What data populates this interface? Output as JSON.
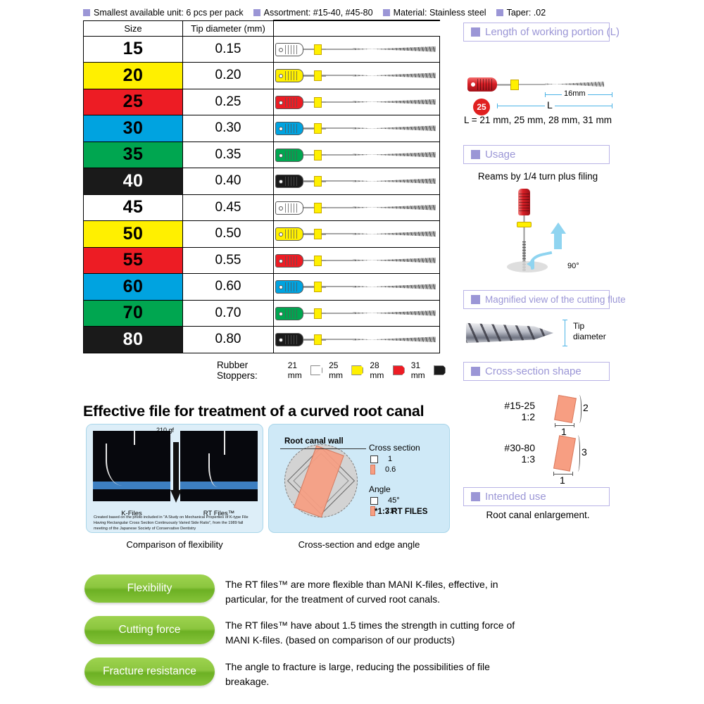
{
  "specs": [
    {
      "label": "Smallest available unit: 6 pcs per pack"
    },
    {
      "label": "Assortment: #15-40, #45-80"
    },
    {
      "label": "Material: Stainless steel"
    },
    {
      "label": "Taper: .02"
    }
  ],
  "table": {
    "headers": {
      "size": "Size",
      "diameter": "Tip diameter (mm)"
    },
    "rows": [
      {
        "size": "15",
        "diameter": "0.15",
        "color": "#FFFFFF",
        "text_color": "#000000"
      },
      {
        "size": "20",
        "diameter": "0.20",
        "color": "#FFF000",
        "text_color": "#000000"
      },
      {
        "size": "25",
        "diameter": "0.25",
        "color": "#ED1C24",
        "text_color": "#000000"
      },
      {
        "size": "30",
        "diameter": "0.30",
        "color": "#00A3E0",
        "text_color": "#000000"
      },
      {
        "size": "35",
        "diameter": "0.35",
        "color": "#00A650",
        "text_color": "#000000"
      },
      {
        "size": "40",
        "diameter": "0.40",
        "color": "#1A1A1A",
        "text_color": "#FFFFFF"
      },
      {
        "size": "45",
        "diameter": "0.45",
        "color": "#FFFFFF",
        "text_color": "#000000"
      },
      {
        "size": "50",
        "diameter": "0.50",
        "color": "#FFF000",
        "text_color": "#000000"
      },
      {
        "size": "55",
        "diameter": "0.55",
        "color": "#ED1C24",
        "text_color": "#000000"
      },
      {
        "size": "60",
        "diameter": "0.60",
        "color": "#00A3E0",
        "text_color": "#000000"
      },
      {
        "size": "70",
        "diameter": "0.70",
        "color": "#00A650",
        "text_color": "#000000"
      },
      {
        "size": "80",
        "diameter": "0.80",
        "color": "#1A1A1A",
        "text_color": "#FFFFFF"
      }
    ]
  },
  "stoppers": {
    "label": "Rubber Stoppers:",
    "items": [
      {
        "length": "21 mm",
        "color": "#FFFFFF"
      },
      {
        "length": "25 mm",
        "color": "#FFF000"
      },
      {
        "length": "28 mm",
        "color": "#ED1C24"
      },
      {
        "length": "31 mm",
        "color": "#1A1A1A"
      }
    ]
  },
  "panels": {
    "working_length": {
      "title": "Length of working portion (L)",
      "flute_dim": "16mm",
      "total_dim": "L",
      "badge": "25",
      "note": "L = 21 mm, 25 mm, 28 mm, 31 mm"
    },
    "usage": {
      "title": "Usage",
      "description": "Reams by 1/4 turn plus filing",
      "angle": "90°"
    },
    "magnified_flute": {
      "title": "Magnified view of the cutting flute",
      "dim_label_line1": "Tip",
      "dim_label_line2": "diameter"
    },
    "cross_section_shape": {
      "title": "Cross-section shape",
      "rows": [
        {
          "sizes": "#15-25",
          "ratio": "1:2",
          "height_label": "2",
          "width_label": "1"
        },
        {
          "sizes": "#30-80",
          "ratio": "1:3",
          "height_label": "3",
          "width_label": "1"
        }
      ]
    },
    "intended_use": {
      "title": "Intended use",
      "description": "Root canal enlargement."
    }
  },
  "effective": {
    "heading": "Effective file for treatment of a curved root canal",
    "flexibility_card": {
      "force_label": "210 gf",
      "left_photo_label": "K-Files",
      "right_photo_label": "RT Files™",
      "citation": "Created based on the photo included in \"A Study on Mechanical Properties of K-type File Having Rectangular Cross Section Continuously Varied Side Ratio\", from the 1989 fall meeting of the Japanese Society of Conservative Dentistry"
    },
    "cross_section_card": {
      "canal_wall_label": "Root canal wall",
      "cross_section_title": "Cross section",
      "cross_section_square_value": "1",
      "cross_section_orange_value": "0.6",
      "angle_title": "Angle",
      "angle_square_value": "45°",
      "angle_orange_value": "71°",
      "footnote": "*1:3 RT FILES"
    },
    "captions": {
      "left": "Comparison of flexibility",
      "right": "Cross-section and edge angle"
    }
  },
  "features": [
    {
      "label": "Flexibility",
      "text": "The RT files™ are more flexible than MANI K-files, effective, in particular, for the treatment of curved root canals."
    },
    {
      "label": "Cutting force",
      "text": "The RT files™ have about 1.5 times the strength in cutting force of MANI K-files.  (based on comparison of our products)"
    },
    {
      "label": "Fracture resistance",
      "text": "The angle to fracture is large, reducing the possibilities of file breakage."
    }
  ],
  "colors": {
    "panel_accent": "#9b96d6",
    "pill_green": "#8cc63f",
    "dimension_blue": "#4bb3e6",
    "cross_section_orange": "#f79e82"
  }
}
